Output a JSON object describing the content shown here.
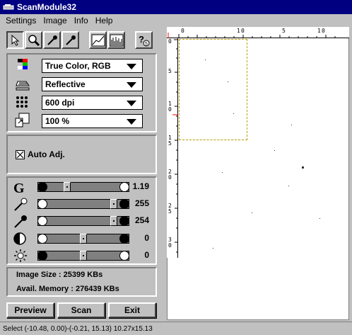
{
  "window": {
    "title": "ScanModule32"
  },
  "menu": [
    "Settings",
    "Image",
    "Info",
    "Help"
  ],
  "toolbar": {
    "icons": [
      "pointer-icon",
      "zoom-icon",
      "eyedropper-icon",
      "eyedropper-white-icon",
      "curve-icon",
      "histogram-icon",
      "help-icon"
    ]
  },
  "settings": {
    "color_mode": "True Color, RGB",
    "source": "Reflective",
    "resolution": "600 dpi",
    "scale": "100 %",
    "auto_adjust": {
      "label": "Auto Adj.",
      "checked": true
    }
  },
  "sliders": [
    {
      "name": "gamma",
      "icon": "gamma-icon",
      "value": "1.19"
    },
    {
      "name": "white-point",
      "icon": "eyedropper-icon",
      "value": "255"
    },
    {
      "name": "black-point",
      "icon": "eyedropper-icon",
      "value": "254"
    },
    {
      "name": "contrast",
      "icon": "contrast-icon",
      "value": "0"
    },
    {
      "name": "brightness",
      "icon": "brightness-icon",
      "value": "0"
    }
  ],
  "info": {
    "image_size": "Image Size : 25399 KBs",
    "avail_memory": "Avail. Memory : 276439 KBs"
  },
  "buttons": {
    "preview": "Preview",
    "scan": "Scan",
    "exit": "Exit"
  },
  "status": "Select (-10.48, 0.00)-(-0.21, 15.13) 10.27x15.13",
  "ruler": {
    "top_labels": [
      "0",
      "1",
      "0",
      "1",
      "5",
      "0"
    ],
    "left_labels": [
      "0",
      "5",
      "1",
      "0",
      "1",
      "5",
      "2",
      "0",
      "2",
      "5",
      "3",
      "0"
    ]
  }
}
